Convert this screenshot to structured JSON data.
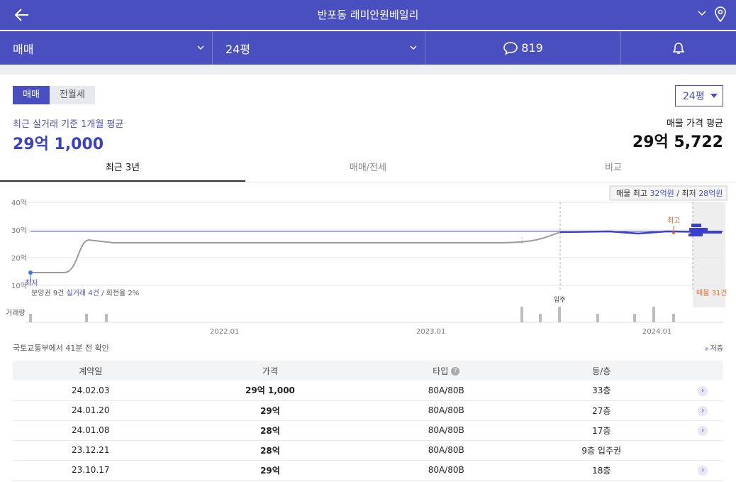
{
  "header": {
    "title": "반포동 래미안원베일리"
  },
  "filters": {
    "trade": "매매",
    "area": "24평",
    "comments": "819"
  },
  "segment": {
    "buy": "매매",
    "rent": "전월세"
  },
  "recent": {
    "label": "최근 실거래 기준 1개월 평균",
    "value": "29억 1,000"
  },
  "listing": {
    "button": "24평",
    "label": "매물 가격 평균",
    "value": "29억 5,722"
  },
  "tabs": [
    "최근 3년",
    "매매/전세",
    "비교"
  ],
  "chart_data": {
    "type": "line",
    "y_ticks": [
      "40억",
      "30억",
      "20억",
      "10억"
    ],
    "ylim": [
      10,
      40
    ],
    "x_ticks": [
      "2022.01",
      "2023.01",
      "2024.01"
    ],
    "tooltip": {
      "prefix": "매물 최고",
      "max": "32억원",
      "sep": "/ 최저",
      "min": "28억원"
    },
    "labels": {
      "high": "최고",
      "low": "최저",
      "move_in": "입주",
      "listing_count": "매물 31건",
      "volume": "거래량"
    },
    "summary": {
      "presale": "분양권 9건",
      "real": "실거래 4건",
      "turnover": "/ 회전율 2%"
    },
    "series": [
      {
        "values_time": [
          0,
          0.13,
          0.2,
          0.25,
          0.37,
          0.5,
          0.63,
          0.75,
          0.98
        ],
        "values": [
          14.5,
          14.5,
          24,
          25.5,
          25.5,
          25.5,
          25.5,
          25.5,
          29
        ],
        "color": "#9b9b9b"
      },
      {
        "values_time": [
          0.98,
          1.1,
          1.2,
          1.3,
          1.35,
          1.45
        ],
        "values": [
          29,
          29,
          29.1,
          28.5,
          29.2,
          29.1
        ],
        "color": "#3b3fcf"
      }
    ]
  },
  "source_note": "국토교통부에서 41분 전 확인",
  "legend": "저층",
  "table": {
    "headers": [
      "계약일",
      "가격",
      "타입",
      "동/층"
    ],
    "rows": [
      [
        "24.02.03",
        "29억 1,000",
        "80A/80B",
        "33층"
      ],
      [
        "24.01.20",
        "29억",
        "80A/80B",
        "27층"
      ],
      [
        "24.01.08",
        "28억",
        "80A/80B",
        "17층"
      ],
      [
        "23.12.21",
        "28억",
        "80A/80B",
        "9층 입주권"
      ],
      [
        "23.10.17",
        "29억",
        "80A/80B",
        "18층"
      ]
    ]
  }
}
